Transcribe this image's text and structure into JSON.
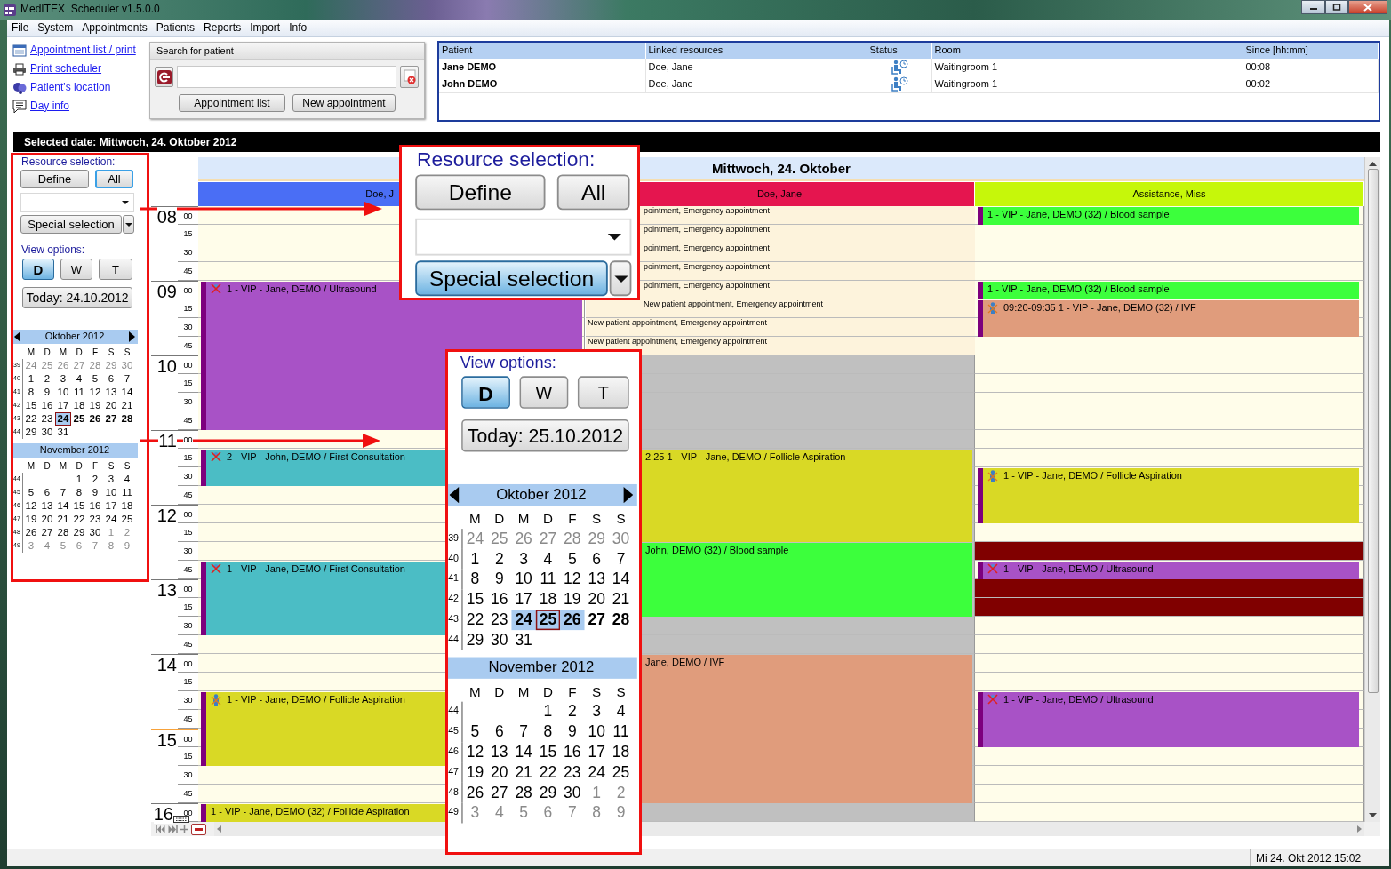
{
  "window": {
    "title": "MedITEX  Scheduler v1.5.0.0"
  },
  "menu": [
    "File",
    "System",
    "Appointments",
    "Patients",
    "Reports",
    "Import",
    "Info"
  ],
  "quick_links": [
    {
      "label": "Appointment list / print",
      "kind": "list"
    },
    {
      "label": "Print scheduler",
      "kind": "printer"
    },
    {
      "label": "Patient's location",
      "kind": "people"
    },
    {
      "label": "Day info",
      "kind": "note"
    }
  ],
  "patient_search": {
    "title": "Search for patient",
    "buttons": [
      "Appointment list",
      "New appointment"
    ]
  },
  "patient_table": {
    "columns": [
      "Patient",
      "Linked resources",
      "Status",
      "Room",
      "Since [hh:mm]"
    ],
    "rows": [
      {
        "patient": "Jane DEMO",
        "linked": "Doe, Jane",
        "waiting": true,
        "room": "Waitingroom 1",
        "since": "00:08"
      },
      {
        "patient": "John DEMO",
        "linked": "Doe, Jane",
        "waiting": true,
        "room": "Waitingroom 1",
        "since": "00:02"
      }
    ]
  },
  "selected_date": "Selected date: Mittwoch, 24. Oktober 2012",
  "left_panel": {
    "resource_selection": {
      "label": "Resource selection:",
      "buttons": [
        {
          "label": "Define",
          "selected": false
        },
        {
          "label": "All",
          "selected": true
        }
      ],
      "special": {
        "label": "Special selection",
        "selected": false
      }
    },
    "view_options": {
      "label": "View options:",
      "modes": [
        {
          "label": "D",
          "selected": true
        },
        {
          "label": "W",
          "selected": false
        },
        {
          "label": "T",
          "selected": false
        }
      ],
      "today": "Today: 24.10.2012",
      "calendars": [
        {
          "title": "Oktober 2012",
          "arrows": true,
          "weekdays": [
            "M",
            "D",
            "M",
            "D",
            "F",
            "S",
            "S"
          ],
          "weeks": [
            {
              "week": "39",
              "days": [
                {
                  "day": "24",
                  "kind": "other",
                  "selected": false
                },
                {
                  "day": "25",
                  "kind": "other",
                  "selected": false
                },
                {
                  "day": "26",
                  "kind": "other",
                  "selected": false
                },
                {
                  "day": "27",
                  "kind": "other",
                  "selected": false
                },
                {
                  "day": "28",
                  "kind": "other",
                  "selected": false
                },
                {
                  "day": "29",
                  "kind": "other",
                  "selected": false
                },
                {
                  "day": "30",
                  "kind": "other",
                  "selected": false
                }
              ]
            },
            {
              "week": "40",
              "days": [
                {
                  "day": "1",
                  "kind": "day",
                  "selected": false
                },
                {
                  "day": "2",
                  "kind": "day",
                  "selected": false
                },
                {
                  "day": "3",
                  "kind": "day",
                  "selected": false
                },
                {
                  "day": "4",
                  "kind": "day",
                  "selected": false
                },
                {
                  "day": "5",
                  "kind": "day",
                  "selected": false
                },
                {
                  "day": "6",
                  "kind": "day",
                  "selected": false
                },
                {
                  "day": "7",
                  "kind": "day",
                  "selected": false
                }
              ]
            },
            {
              "week": "41",
              "days": [
                {
                  "day": "8",
                  "kind": "day",
                  "selected": false
                },
                {
                  "day": "9",
                  "kind": "day",
                  "selected": false
                },
                {
                  "day": "10",
                  "kind": "day",
                  "selected": false
                },
                {
                  "day": "11",
                  "kind": "day",
                  "selected": false
                },
                {
                  "day": "12",
                  "kind": "day",
                  "selected": false
                },
                {
                  "day": "13",
                  "kind": "day",
                  "selected": false
                },
                {
                  "day": "14",
                  "kind": "day",
                  "selected": false
                }
              ]
            },
            {
              "week": "42",
              "days": [
                {
                  "day": "15",
                  "kind": "day",
                  "selected": false
                },
                {
                  "day": "16",
                  "kind": "day",
                  "selected": false
                },
                {
                  "day": "17",
                  "kind": "day",
                  "selected": false
                },
                {
                  "day": "18",
                  "kind": "day",
                  "selected": false
                },
                {
                  "day": "19",
                  "kind": "day",
                  "selected": false
                },
                {
                  "day": "20",
                  "kind": "day",
                  "selected": false
                },
                {
                  "day": "21",
                  "kind": "day",
                  "selected": false
                }
              ]
            },
            {
              "week": "43",
              "days": [
                {
                  "day": "22",
                  "kind": "day",
                  "selected": false
                },
                {
                  "day": "23",
                  "kind": "day",
                  "selected": false
                },
                {
                  "day": "24",
                  "kind": "range",
                  "selected": true
                },
                {
                  "day": "25",
                  "kind": "bold",
                  "selected": false
                },
                {
                  "day": "26",
                  "kind": "bold",
                  "selected": false
                },
                {
                  "day": "27",
                  "kind": "bold",
                  "selected": false
                },
                {
                  "day": "28",
                  "kind": "bold",
                  "selected": false
                }
              ]
            },
            {
              "week": "44",
              "days": [
                {
                  "day": "29",
                  "kind": "day",
                  "selected": false
                },
                {
                  "day": "30",
                  "kind": "day",
                  "selected": false
                },
                {
                  "day": "31",
                  "kind": "day",
                  "selected": false
                }
              ]
            }
          ]
        },
        {
          "title": "November 2012",
          "arrows": false,
          "weekdays": [
            "M",
            "D",
            "M",
            "D",
            "F",
            "S",
            "S"
          ],
          "weeks": [
            {
              "week": "44",
              "days": [
                {
                  "day": "1",
                  "kind": "day",
                  "selected": false
                },
                {
                  "day": "2",
                  "kind": "day",
                  "selected": false
                },
                {
                  "day": "3",
                  "kind": "day",
                  "selected": false
                },
                {
                  "day": "4",
                  "kind": "day",
                  "selected": false
                }
              ]
            },
            {
              "week": "45",
              "days": [
                {
                  "day": "5",
                  "kind": "day",
                  "selected": false
                },
                {
                  "day": "6",
                  "kind": "day",
                  "selected": false
                },
                {
                  "day": "7",
                  "kind": "day",
                  "selected": false
                },
                {
                  "day": "8",
                  "kind": "day",
                  "selected": false
                },
                {
                  "day": "9",
                  "kind": "day",
                  "selected": false
                },
                {
                  "day": "10",
                  "kind": "day",
                  "selected": false
                },
                {
                  "day": "11",
                  "kind": "day",
                  "selected": false
                }
              ]
            },
            {
              "week": "46",
              "days": [
                {
                  "day": "12",
                  "kind": "day",
                  "selected": false
                },
                {
                  "day": "13",
                  "kind": "day",
                  "selected": false
                },
                {
                  "day": "14",
                  "kind": "day",
                  "selected": false
                },
                {
                  "day": "15",
                  "kind": "day",
                  "selected": false
                },
                {
                  "day": "16",
                  "kind": "day",
                  "selected": false
                },
                {
                  "day": "17",
                  "kind": "day",
                  "selected": false
                },
                {
                  "day": "18",
                  "kind": "day",
                  "selected": false
                }
              ]
            },
            {
              "week": "47",
              "days": [
                {
                  "day": "19",
                  "kind": "day",
                  "selected": false
                },
                {
                  "day": "20",
                  "kind": "day",
                  "selected": false
                },
                {
                  "day": "21",
                  "kind": "day",
                  "selected": false
                },
                {
                  "day": "22",
                  "kind": "day",
                  "selected": false
                },
                {
                  "day": "23",
                  "kind": "day",
                  "selected": false
                },
                {
                  "day": "24",
                  "kind": "day",
                  "selected": false
                },
                {
                  "day": "25",
                  "kind": "day",
                  "selected": false
                }
              ]
            },
            {
              "week": "48",
              "days": [
                {
                  "day": "26",
                  "kind": "day",
                  "selected": false
                },
                {
                  "day": "27",
                  "kind": "day",
                  "selected": false
                },
                {
                  "day": "28",
                  "kind": "day",
                  "selected": false
                },
                {
                  "day": "29",
                  "kind": "day",
                  "selected": false
                },
                {
                  "day": "30",
                  "kind": "day",
                  "selected": false
                },
                {
                  "day": "1",
                  "kind": "other",
                  "selected": false
                },
                {
                  "day": "2",
                  "kind": "other",
                  "selected": false
                }
              ]
            },
            {
              "week": "49",
              "days": [
                {
                  "day": "3",
                  "kind": "other",
                  "selected": false
                },
                {
                  "day": "4",
                  "kind": "other",
                  "selected": false
                },
                {
                  "day": "5",
                  "kind": "other",
                  "selected": false
                },
                {
                  "day": "6",
                  "kind": "other",
                  "selected": false
                },
                {
                  "day": "7",
                  "kind": "other",
                  "selected": false
                },
                {
                  "day": "8",
                  "kind": "other",
                  "selected": false
                },
                {
                  "day": "9",
                  "kind": "other",
                  "selected": false
                }
              ]
            }
          ]
        }
      ]
    }
  },
  "callouts": [
    {
      "kind": "resource_selection",
      "label": "Resource selection:",
      "buttons": [
        {
          "label": "Define",
          "selected": false
        },
        {
          "label": "All",
          "selected": false
        }
      ],
      "special": {
        "label": "Special selection",
        "selected": true
      }
    },
    {
      "kind": "view_options",
      "label": "View options:",
      "modes": [
        {
          "label": "D",
          "selected": true
        },
        {
          "label": "W",
          "selected": false
        },
        {
          "label": "T",
          "selected": false
        }
      ],
      "today": "Today: 25.10.2012",
      "calendars": [
        {
          "title": "Oktober 2012",
          "arrows": true,
          "weekdays": [
            "M",
            "D",
            "M",
            "D",
            "F",
            "S",
            "S"
          ],
          "weeks": [
            {
              "week": "39",
              "days": [
                {
                  "day": "24",
                  "kind": "other",
                  "selected": false
                },
                {
                  "day": "25",
                  "kind": "other",
                  "selected": false
                },
                {
                  "day": "26",
                  "kind": "other",
                  "selected": false
                },
                {
                  "day": "27",
                  "kind": "other",
                  "selected": false
                },
                {
                  "day": "28",
                  "kind": "other",
                  "selected": false
                },
                {
                  "day": "29",
                  "kind": "other",
                  "selected": false
                },
                {
                  "day": "30",
                  "kind": "other",
                  "selected": false
                }
              ]
            },
            {
              "week": "40",
              "days": [
                {
                  "day": "1",
                  "kind": "day",
                  "selected": false
                },
                {
                  "day": "2",
                  "kind": "day",
                  "selected": false
                },
                {
                  "day": "3",
                  "kind": "day",
                  "selected": false
                },
                {
                  "day": "4",
                  "kind": "day",
                  "selected": false
                },
                {
                  "day": "5",
                  "kind": "day",
                  "selected": false
                },
                {
                  "day": "6",
                  "kind": "day",
                  "selected": false
                },
                {
                  "day": "7",
                  "kind": "day",
                  "selected": false
                }
              ]
            },
            {
              "week": "41",
              "days": [
                {
                  "day": "8",
                  "kind": "day",
                  "selected": false
                },
                {
                  "day": "9",
                  "kind": "day",
                  "selected": false
                },
                {
                  "day": "10",
                  "kind": "day",
                  "selected": false
                },
                {
                  "day": "11",
                  "kind": "day",
                  "selected": false
                },
                {
                  "day": "12",
                  "kind": "day",
                  "selected": false
                },
                {
                  "day": "13",
                  "kind": "day",
                  "selected": false
                },
                {
                  "day": "14",
                  "kind": "day",
                  "selected": false
                }
              ]
            },
            {
              "week": "42",
              "days": [
                {
                  "day": "15",
                  "kind": "day",
                  "selected": false
                },
                {
                  "day": "16",
                  "kind": "day",
                  "selected": false
                },
                {
                  "day": "17",
                  "kind": "day",
                  "selected": false
                },
                {
                  "day": "18",
                  "kind": "day",
                  "selected": false
                },
                {
                  "day": "19",
                  "kind": "day",
                  "selected": false
                },
                {
                  "day": "20",
                  "kind": "day",
                  "selected": false
                },
                {
                  "day": "21",
                  "kind": "day",
                  "selected": false
                }
              ]
            },
            {
              "week": "43",
              "days": [
                {
                  "day": "22",
                  "kind": "day",
                  "selected": false
                },
                {
                  "day": "23",
                  "kind": "day",
                  "selected": false
                },
                {
                  "day": "24",
                  "kind": "range",
                  "selected": false
                },
                {
                  "day": "25",
                  "kind": "range",
                  "selected": true
                },
                {
                  "day": "26",
                  "kind": "range",
                  "selected": false
                },
                {
                  "day": "27",
                  "kind": "bold",
                  "selected": false
                },
                {
                  "day": "28",
                  "kind": "bold",
                  "selected": false
                }
              ]
            },
            {
              "week": "44",
              "days": [
                {
                  "day": "29",
                  "kind": "day",
                  "selected": false
                },
                {
                  "day": "30",
                  "kind": "day",
                  "selected": false
                },
                {
                  "day": "31",
                  "kind": "day",
                  "selected": false
                }
              ]
            }
          ]
        },
        {
          "title": "November 2012",
          "arrows": false,
          "weekdays": [
            "M",
            "D",
            "M",
            "D",
            "F",
            "S",
            "S"
          ],
          "weeks": [
            {
              "week": "44",
              "days": [
                {
                  "day": "1",
                  "kind": "day",
                  "selected": false
                },
                {
                  "day": "2",
                  "kind": "day",
                  "selected": false
                },
                {
                  "day": "3",
                  "kind": "day",
                  "selected": false
                },
                {
                  "day": "4",
                  "kind": "day",
                  "selected": false
                }
              ]
            },
            {
              "week": "45",
              "days": [
                {
                  "day": "5",
                  "kind": "day",
                  "selected": false
                },
                {
                  "day": "6",
                  "kind": "day",
                  "selected": false
                },
                {
                  "day": "7",
                  "kind": "day",
                  "selected": false
                },
                {
                  "day": "8",
                  "kind": "day",
                  "selected": false
                },
                {
                  "day": "9",
                  "kind": "day",
                  "selected": false
                },
                {
                  "day": "10",
                  "kind": "day",
                  "selected": false
                },
                {
                  "day": "11",
                  "kind": "day",
                  "selected": false
                }
              ]
            },
            {
              "week": "46",
              "days": [
                {
                  "day": "12",
                  "kind": "day",
                  "selected": false
                },
                {
                  "day": "13",
                  "kind": "day",
                  "selected": false
                },
                {
                  "day": "14",
                  "kind": "day",
                  "selected": false
                },
                {
                  "day": "15",
                  "kind": "day",
                  "selected": false
                },
                {
                  "day": "16",
                  "kind": "day",
                  "selected": false
                },
                {
                  "day": "17",
                  "kind": "day",
                  "selected": false
                },
                {
                  "day": "18",
                  "kind": "day",
                  "selected": false
                }
              ]
            },
            {
              "week": "47",
              "days": [
                {
                  "day": "19",
                  "kind": "day",
                  "selected": false
                },
                {
                  "day": "20",
                  "kind": "day",
                  "selected": false
                },
                {
                  "day": "21",
                  "kind": "day",
                  "selected": false
                },
                {
                  "day": "22",
                  "kind": "day",
                  "selected": false
                },
                {
                  "day": "23",
                  "kind": "day",
                  "selected": false
                },
                {
                  "day": "24",
                  "kind": "day",
                  "selected": false
                },
                {
                  "day": "25",
                  "kind": "day",
                  "selected": false
                }
              ]
            },
            {
              "week": "48",
              "days": [
                {
                  "day": "26",
                  "kind": "day",
                  "selected": false
                },
                {
                  "day": "27",
                  "kind": "day",
                  "selected": false
                },
                {
                  "day": "28",
                  "kind": "day",
                  "selected": false
                },
                {
                  "day": "29",
                  "kind": "day",
                  "selected": false
                },
                {
                  "day": "30",
                  "kind": "day",
                  "selected": false
                },
                {
                  "day": "1",
                  "kind": "other",
                  "selected": false
                },
                {
                  "day": "2",
                  "kind": "other",
                  "selected": false
                }
              ]
            },
            {
              "week": "49",
              "days": [
                {
                  "day": "3",
                  "kind": "other",
                  "selected": false
                },
                {
                  "day": "4",
                  "kind": "other",
                  "selected": false
                },
                {
                  "day": "5",
                  "kind": "other",
                  "selected": false
                },
                {
                  "day": "6",
                  "kind": "other",
                  "selected": false
                },
                {
                  "day": "7",
                  "kind": "other",
                  "selected": false
                },
                {
                  "day": "8",
                  "kind": "other",
                  "selected": false
                },
                {
                  "day": "9",
                  "kind": "other",
                  "selected": false
                }
              ]
            }
          ]
        }
      ]
    }
  ],
  "scheduler": {
    "day": "Mittwoch, 24. Oktober",
    "hours": [
      {
        "hour": "08",
        "minutes": [
          "00",
          "15",
          "30",
          "45"
        ],
        "current": false,
        "marked": false
      },
      {
        "hour": "09",
        "minutes": [
          "00",
          "15",
          "30",
          "45"
        ],
        "current": false,
        "marked": false
      },
      {
        "hour": "10",
        "minutes": [
          "00",
          "15",
          "30",
          "45"
        ],
        "current": false,
        "marked": false
      },
      {
        "hour": "11",
        "minutes": [
          "00",
          "15",
          "30",
          "45"
        ],
        "current": false,
        "marked": false
      },
      {
        "hour": "12",
        "minutes": [
          "00",
          "15",
          "30",
          "45"
        ],
        "current": false,
        "marked": false
      },
      {
        "hour": "13",
        "minutes": [
          "00",
          "15",
          "30",
          "45"
        ],
        "current": false,
        "marked": false
      },
      {
        "hour": "14",
        "minutes": [
          "00",
          "15",
          "30",
          "45"
        ],
        "current": false,
        "marked": false
      },
      {
        "hour": "15",
        "minutes": [
          "00",
          "15",
          "30",
          "45"
        ],
        "current": true,
        "marked": false
      },
      {
        "hour": "16",
        "minutes": [
          "00"
        ],
        "current": false,
        "marked": true
      }
    ],
    "resources": [
      {
        "name": "Doe, J",
        "color": "#4a6ef5",
        "rows": [
          {
            "kind": "free"
          },
          {
            "kind": "free"
          },
          {
            "kind": "free"
          },
          {
            "kind": "free"
          },
          {
            "kind": "appointment",
            "color": "#a852c6",
            "cancelled": true,
            "present": false,
            "text": "1 - VIP - Jane, DEMO / Ultrasound"
          },
          {
            "kind": "continued"
          },
          {
            "kind": "continued"
          },
          {
            "kind": "continued"
          },
          {
            "kind": "continued"
          },
          {
            "kind": "continued"
          },
          {
            "kind": "continued"
          },
          {
            "kind": "continued"
          },
          {
            "kind": "free"
          },
          {
            "kind": "appointment",
            "color": "#4bbdc5",
            "cancelled": true,
            "present": false,
            "text": "2 - VIP - John, DEMO / First Consultation"
          },
          {
            "kind": "continued"
          },
          {
            "kind": "free"
          },
          {
            "kind": "free"
          },
          {
            "kind": "free"
          },
          {
            "kind": "free"
          },
          {
            "kind": "appointment",
            "color": "#4bbdc5",
            "cancelled": true,
            "present": false,
            "text": "1 - VIP - Jane, DEMO / First Consultation"
          },
          {
            "kind": "continued"
          },
          {
            "kind": "continued"
          },
          {
            "kind": "continued"
          },
          {
            "kind": "free"
          },
          {
            "kind": "free"
          },
          {
            "kind": "free"
          },
          {
            "kind": "appointment",
            "color": "#d9d925",
            "cancelled": false,
            "present": true,
            "text": "1 - VIP - Jane, DEMO / Follicle Aspiration"
          },
          {
            "kind": "continued"
          },
          {
            "kind": "continued"
          },
          {
            "kind": "continued"
          },
          {
            "kind": "free"
          },
          {
            "kind": "free"
          },
          {
            "kind": "appointment",
            "color": "#d9d925",
            "cancelled": false,
            "present": false,
            "text": "1 - VIP - Jane, DEMO (32) / Follicle Aspiration"
          }
        ]
      },
      {
        "name": "Doe, Jane",
        "color": "#e5154f",
        "rows": [
          {
            "kind": "slot",
            "text": "pointment, Emergency appointment"
          },
          {
            "kind": "slot",
            "text": "pointment, Emergency appointment"
          },
          {
            "kind": "slot",
            "text": "pointment, Emergency appointment"
          },
          {
            "kind": "slot",
            "text": "pointment, Emergency appointment"
          },
          {
            "kind": "slot",
            "text": "pointment, Emergency appointment"
          },
          {
            "kind": "slot",
            "text": "New patient appointment, Emergency appointment"
          },
          {
            "kind": "slot",
            "text": "New patient appointment, Emergency appointment"
          },
          {
            "kind": "slot",
            "text": "New patient appointment, Emergency appointment"
          },
          {
            "kind": "unavailable"
          },
          {
            "kind": "unavailable"
          },
          {
            "kind": "unavailable"
          },
          {
            "kind": "unavailable"
          },
          {
            "kind": "unavailable"
          },
          {
            "kind": "appointment",
            "color": "#d9d925",
            "cancelled": false,
            "present": false,
            "text": "2:25 1 - VIP - Jane, DEMO / Follicle Aspiration"
          },
          {
            "kind": "continued"
          },
          {
            "kind": "continued"
          },
          {
            "kind": "continued"
          },
          {
            "kind": "continued"
          },
          {
            "kind": "appointment",
            "color": "#3cff3c",
            "cancelled": false,
            "present": false,
            "text": "John, DEMO (32) / Blood sample"
          },
          {
            "kind": "continued"
          },
          {
            "kind": "continued"
          },
          {
            "kind": "continued"
          },
          {
            "kind": "unavailable"
          },
          {
            "kind": "unavailable"
          },
          {
            "kind": "appointment",
            "color": "#e09c7c",
            "cancelled": false,
            "present": false,
            "text": "Jane, DEMO / IVF"
          },
          {
            "kind": "continued"
          },
          {
            "kind": "continued"
          },
          {
            "kind": "continued"
          },
          {
            "kind": "continued"
          },
          {
            "kind": "continued"
          },
          {
            "kind": "continued"
          },
          {
            "kind": "continued"
          },
          {
            "kind": "unavailable"
          }
        ]
      },
      {
        "name": "Assistance, Miss",
        "color": "#c6f70a",
        "rows": [
          {
            "kind": "appointment",
            "color": "#3cff3c",
            "cancelled": false,
            "present": false,
            "text": "1 - VIP - Jane, DEMO (32) / Blood sample"
          },
          {
            "kind": "free"
          },
          {
            "kind": "free"
          },
          {
            "kind": "free"
          },
          {
            "kind": "appointment",
            "color": "#3cff3c",
            "cancelled": false,
            "present": false,
            "text": "1 - VIP - Jane, DEMO (32) / Blood sample"
          },
          {
            "kind": "appointment",
            "color": "#e09c7c",
            "cancelled": false,
            "present": true,
            "text": "09:20-09:35 1 - VIP - Jane, DEMO (32) / IVF"
          },
          {
            "kind": "continued"
          },
          {
            "kind": "free"
          },
          {
            "kind": "free"
          },
          {
            "kind": "free"
          },
          {
            "kind": "free"
          },
          {
            "kind": "free"
          },
          {
            "kind": "free"
          },
          {
            "kind": "free"
          },
          {
            "kind": "appointment",
            "color": "#d9d925",
            "cancelled": false,
            "present": true,
            "text": "1 - VIP - Jane, DEMO / Follicle Aspiration"
          },
          {
            "kind": "continued"
          },
          {
            "kind": "continued"
          },
          {
            "kind": "free"
          },
          {
            "kind": "blocked",
            "color": "#800000"
          },
          {
            "kind": "appointment",
            "color": "#a852c6",
            "cancelled": true,
            "present": false,
            "text": "1 - VIP - Jane, DEMO / Ultrasound"
          },
          {
            "kind": "blocked",
            "color": "#800000"
          },
          {
            "kind": "blocked",
            "color": "#800000"
          },
          {
            "kind": "free"
          },
          {
            "kind": "free"
          },
          {
            "kind": "free"
          },
          {
            "kind": "free"
          },
          {
            "kind": "appointment",
            "color": "#a852c6",
            "cancelled": true,
            "present": false,
            "text": "1 - VIP - Jane, DEMO / Ultrasound"
          },
          {
            "kind": "continued"
          },
          {
            "kind": "continued"
          },
          {
            "kind": "free"
          },
          {
            "kind": "free"
          },
          {
            "kind": "free"
          },
          {
            "kind": "free"
          }
        ]
      }
    ]
  },
  "status_bar": {
    "datetime": "Mi 24. Okt 2012 15:02"
  }
}
